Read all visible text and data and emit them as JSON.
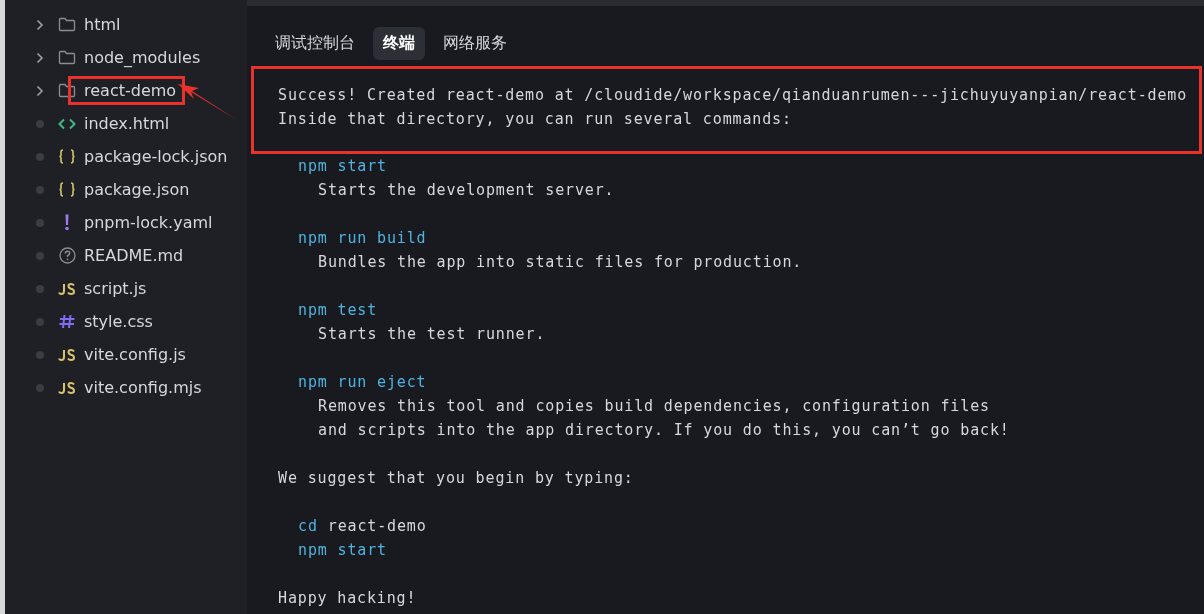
{
  "explorer": {
    "items": [
      {
        "kind": "folder",
        "name": "html",
        "highlighted": false
      },
      {
        "kind": "folder",
        "name": "node_modules",
        "highlighted": false
      },
      {
        "kind": "folder",
        "name": "react-demo",
        "highlighted": true
      },
      {
        "kind": "html",
        "name": "index.html",
        "highlighted": false
      },
      {
        "kind": "json",
        "name": "package-lock.json",
        "highlighted": false
      },
      {
        "kind": "json",
        "name": "package.json",
        "highlighted": false
      },
      {
        "kind": "yaml",
        "name": "pnpm-lock.yaml",
        "highlighted": false
      },
      {
        "kind": "md",
        "name": "README.md",
        "highlighted": false
      },
      {
        "kind": "js",
        "name": "script.js",
        "highlighted": false
      },
      {
        "kind": "css",
        "name": "style.css",
        "highlighted": false
      },
      {
        "kind": "js",
        "name": "vite.config.js",
        "highlighted": false
      },
      {
        "kind": "js",
        "name": "vite.config.mjs",
        "highlighted": false
      }
    ]
  },
  "panel": {
    "tabs": [
      {
        "label": "调试控制台",
        "selected": false
      },
      {
        "label": "终端",
        "selected": true
      },
      {
        "label": "网络服务",
        "selected": false
      }
    ],
    "blocks": [
      {
        "highlighted": true,
        "lines": [
          {
            "kind": "text",
            "text": "Success! Created react-demo at /cloudide/workspace/qianduanrumen---jichuyuyanpian/react-demo"
          },
          {
            "kind": "text",
            "text": "Inside that directory, you can run several commands:"
          }
        ]
      },
      {
        "highlighted": false,
        "lines": [
          {
            "kind": "command",
            "text": "npm start"
          },
          {
            "kind": "note",
            "text": "Starts the development server."
          }
        ]
      },
      {
        "highlighted": false,
        "lines": [
          {
            "kind": "command",
            "text": "npm run build"
          },
          {
            "kind": "note",
            "text": "Bundles the app into static files for production."
          }
        ]
      },
      {
        "highlighted": false,
        "lines": [
          {
            "kind": "command",
            "text": "npm test"
          },
          {
            "kind": "note",
            "text": "Starts the test runner."
          }
        ]
      },
      {
        "highlighted": false,
        "lines": [
          {
            "kind": "command",
            "text": "npm run eject"
          },
          {
            "kind": "note",
            "text": "Removes this tool and copies build dependencies, configuration files"
          },
          {
            "kind": "note",
            "text": "and scripts into the app directory. If you do this, you can’t go back!"
          }
        ]
      },
      {
        "highlighted": false,
        "lines": [
          {
            "kind": "text",
            "text": "We suggest that you begin by typing:"
          }
        ]
      },
      {
        "highlighted": false,
        "lines": [
          {
            "kind": "command",
            "text": "cd",
            "arg": "react-demo"
          },
          {
            "kind": "command",
            "text": "npm start"
          }
        ]
      },
      {
        "highlighted": false,
        "lines": [
          {
            "kind": "text",
            "text": "Happy hacking!"
          }
        ]
      }
    ]
  }
}
